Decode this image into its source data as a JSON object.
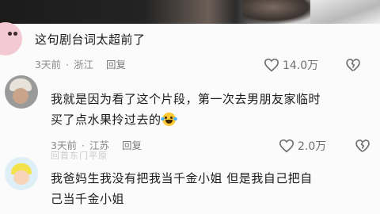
{
  "comments": [
    {
      "text": "这句剧台词太超前了",
      "time": "3天前",
      "location": "浙江",
      "reply_label": "回复",
      "likes": "14.0万"
    },
    {
      "text_line1": "我就是因为看了这个片段，第一次去男朋友家临时",
      "text_line2": "买了点水果拎过去的",
      "time": "3天前",
      "location": "江苏",
      "reply_label": "回复",
      "likes": "2.0万",
      "emoji": "crying-laughing-emoji"
    },
    {
      "text_line1": "我爸妈生我没有把我当千金小姐 但是我自己把自",
      "text_line2": "己当千金小姐"
    }
  ],
  "faint_username": "回首东门平原",
  "colors": {
    "text": "#1a1a1a",
    "meta": "#8a8a8a",
    "icon": "#6f6f6f"
  }
}
